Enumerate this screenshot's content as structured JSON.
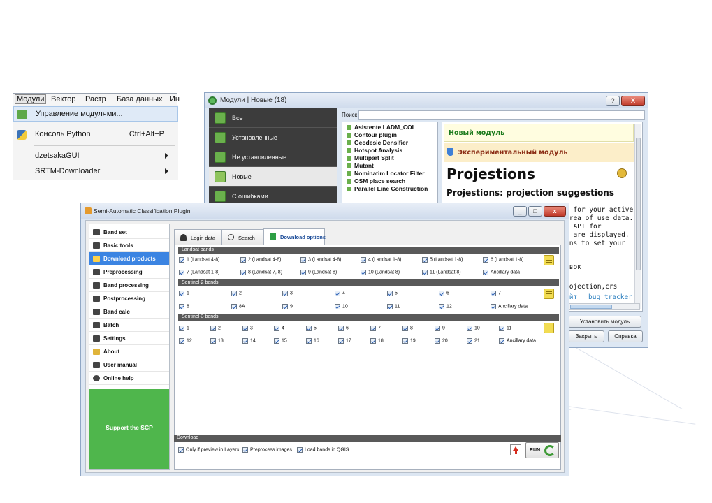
{
  "menu": {
    "bar": [
      "Модули",
      "Вектор",
      "Растр",
      "База данных",
      "Ин"
    ],
    "items": [
      {
        "label": "Управление модулями...",
        "shortcut": "",
        "submenu": false
      },
      {
        "label": "Консоль Python",
        "shortcut": "Ctrl+Alt+P",
        "submenu": false
      },
      {
        "label": "dzetsakaGUI",
        "shortcut": "",
        "submenu": true
      },
      {
        "label": "SRTM-Downloader",
        "shortcut": "",
        "submenu": true
      }
    ]
  },
  "plugins": {
    "title": "Модули | Новые (18)",
    "help_btn": "?",
    "close_btn": "X",
    "sidebar": [
      "Все",
      "Установленные",
      "Не установленные",
      "Новые",
      "С ошибками"
    ],
    "search_label": "Поиск",
    "list": [
      "Asistente LADM_COL",
      "Contour plugin",
      "Geodesic Densifier",
      "Hotspot Analysis",
      "Multipart Split",
      "Mutant",
      "Nominatim Locator Filter",
      "OSM place search",
      "Parallel Line Construction"
    ],
    "detail": {
      "new_module": "Новый модуль",
      "experimental": "Экспериментальный модуль",
      "title": "Projestions",
      "subtitle": "Projestions: projection suggestions",
      "lines": [
        ") for your active",
        "area of use data.",
        "e API for",
        "; are displayed.",
        "ons to set your"
      ],
      "line_more": "овок",
      "tags": "rojection,crs",
      "links": [
        "айт",
        "bug tracker"
      ]
    },
    "buttons": {
      "install": "Установить модуль",
      "close": "Закрыть",
      "help": "Справка"
    }
  },
  "scp": {
    "title": "Semi-Automatic Classification Plugin",
    "nav": [
      "Band set",
      "Basic tools",
      "Download products",
      "Preprocessing",
      "Band processing",
      "Postprocessing",
      "Band calc",
      "Batch",
      "Settings",
      "About",
      "User manual",
      "Online help"
    ],
    "support": "Support the SCP",
    "tabs": [
      "Login data",
      "Search",
      "Download options"
    ],
    "landsat": {
      "header": "Landsat bands",
      "row1": [
        "1 (Landsat 4-8)",
        "2 (Landsat 4-8)",
        "3 (Landsat 4-8)",
        "4 (Landsat 1-8)",
        "5 (Landsat 1-8)",
        "6 (Landsat 1-8)"
      ],
      "row2": [
        "7 (Landsat 1-8)",
        "8 (Landsat 7, 8)",
        "9 (Landsat 8)",
        "10 (Landsat 8)",
        "11 (Landsat 8)",
        "Ancillary data"
      ]
    },
    "sentinel2": {
      "header": "Sentinel-2 bands",
      "row1": [
        "1",
        "2",
        "3",
        "4",
        "5",
        "6",
        "7"
      ],
      "row2": [
        "8",
        "8A",
        "9",
        "10",
        "11",
        "12",
        "Ancillary data"
      ]
    },
    "sentinel3": {
      "header": "Sentinel-3 bands",
      "row1": [
        "1",
        "2",
        "3",
        "4",
        "5",
        "6",
        "7",
        "8",
        "9",
        "10",
        "11"
      ],
      "row2": [
        "12",
        "13",
        "14",
        "15",
        "16",
        "17",
        "18",
        "19",
        "20",
        "21",
        "Ancillary data"
      ]
    },
    "download": {
      "header": "Download",
      "options": [
        "Only if preview in Layers",
        "Preprocess images",
        "Load bands in QGIS"
      ],
      "run": "RUN"
    }
  }
}
